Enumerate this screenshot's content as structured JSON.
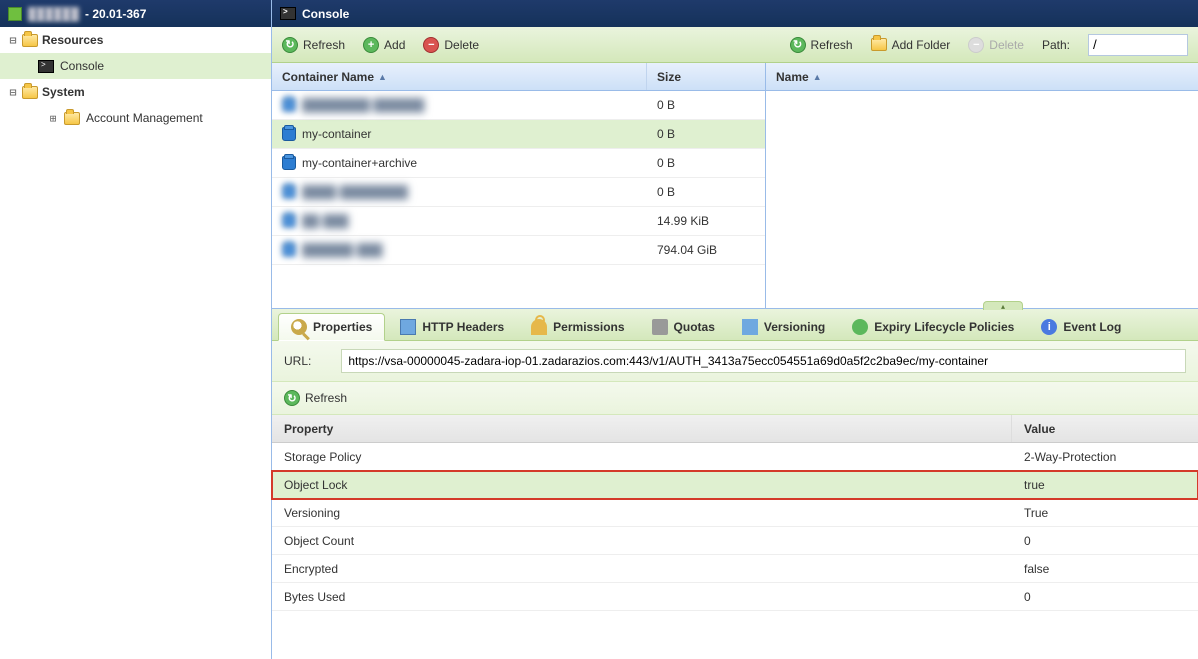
{
  "sidebar": {
    "title_obscured": "██████",
    "title_suffix": " - 20.01-367",
    "resources_label": "Resources",
    "console_label": "Console",
    "system_label": "System",
    "account_label": "Account Management"
  },
  "header": {
    "title": "Console"
  },
  "toolbar_left": {
    "refresh": "Refresh",
    "add": "Add",
    "delete": "Delete"
  },
  "toolbar_right": {
    "refresh": "Refresh",
    "add_folder": "Add Folder",
    "delete": "Delete",
    "path_label": "Path:",
    "path_value": "/"
  },
  "grid_left": {
    "col_name": "Container Name",
    "col_size": "Size",
    "rows": [
      {
        "name": "████████ ██████",
        "size": "0 B",
        "blurred": true
      },
      {
        "name": "my-container",
        "size": "0 B",
        "selected": true
      },
      {
        "name": "my-container+archive",
        "size": "0 B"
      },
      {
        "name": "████-████████",
        "size": "0 B",
        "blurred": true
      },
      {
        "name": "██-███",
        "size": "14.99 KiB",
        "blurred": true
      },
      {
        "name": "██████-███",
        "size": "794.04 GiB",
        "blurred": true
      }
    ]
  },
  "grid_right": {
    "col_name": "Name"
  },
  "tabs": {
    "properties": "Properties",
    "http": "HTTP Headers",
    "permissions": "Permissions",
    "quotas": "Quotas",
    "versioning": "Versioning",
    "expiry": "Expiry Lifecycle Policies",
    "eventlog": "Event Log"
  },
  "props": {
    "url_label": "URL:",
    "url_value": "https://vsa-00000045-zadara-iop-01.zadarazios.com:443/v1/AUTH_3413a75ecc054551a69d0a5f2c2ba9ec/my-container",
    "refresh": "Refresh",
    "col_property": "Property",
    "col_value": "Value",
    "rows": [
      {
        "name": "Storage Policy",
        "value": "2-Way-Protection"
      },
      {
        "name": "Object Lock",
        "value": "true",
        "highlight": true
      },
      {
        "name": "Versioning",
        "value": "True"
      },
      {
        "name": "Object Count",
        "value": "0"
      },
      {
        "name": "Encrypted",
        "value": "false"
      },
      {
        "name": "Bytes Used",
        "value": "0"
      }
    ]
  }
}
